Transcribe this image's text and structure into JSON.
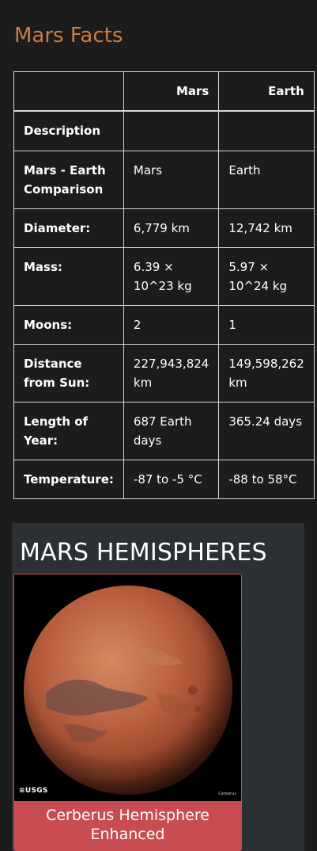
{
  "facts": {
    "title": "Mars Facts",
    "header": {
      "col0": "",
      "col1": "Mars",
      "col2": "Earth"
    },
    "rows": [
      {
        "label": "Description",
        "mars": "",
        "earth": ""
      },
      {
        "label": "Mars - Earth Comparison",
        "mars": "Mars",
        "earth": "Earth"
      },
      {
        "label": "Diameter:",
        "mars": "6,779 km",
        "earth": "12,742 km"
      },
      {
        "label": "Mass:",
        "mars": "6.39 × 10^23 kg",
        "earth": "5.97 × 10^24 kg"
      },
      {
        "label": "Moons:",
        "mars": "2",
        "earth": "1"
      },
      {
        "label": "Distance from Sun:",
        "mars": "227,943,824 km",
        "earth": "149,598,262 km"
      },
      {
        "label": "Length of Year:",
        "mars": "687 Earth days",
        "earth": "365.24 days"
      },
      {
        "label": "Temperature:",
        "mars": "-87 to -5 °C",
        "earth": "-88 to 58°C"
      }
    ]
  },
  "hemispheres": {
    "title": "MARS HEMISPHERES",
    "cards": [
      {
        "caption": "Cerberus Hemisphere Enhanced",
        "logo_text": "≡USGS",
        "image_credit": "Cerberus"
      }
    ]
  },
  "colors": {
    "facts_title": "#cf7c43",
    "caption_bg": "#c84d51",
    "panel_bg": "#2c3034",
    "page_bg": "#1c1c1c"
  }
}
